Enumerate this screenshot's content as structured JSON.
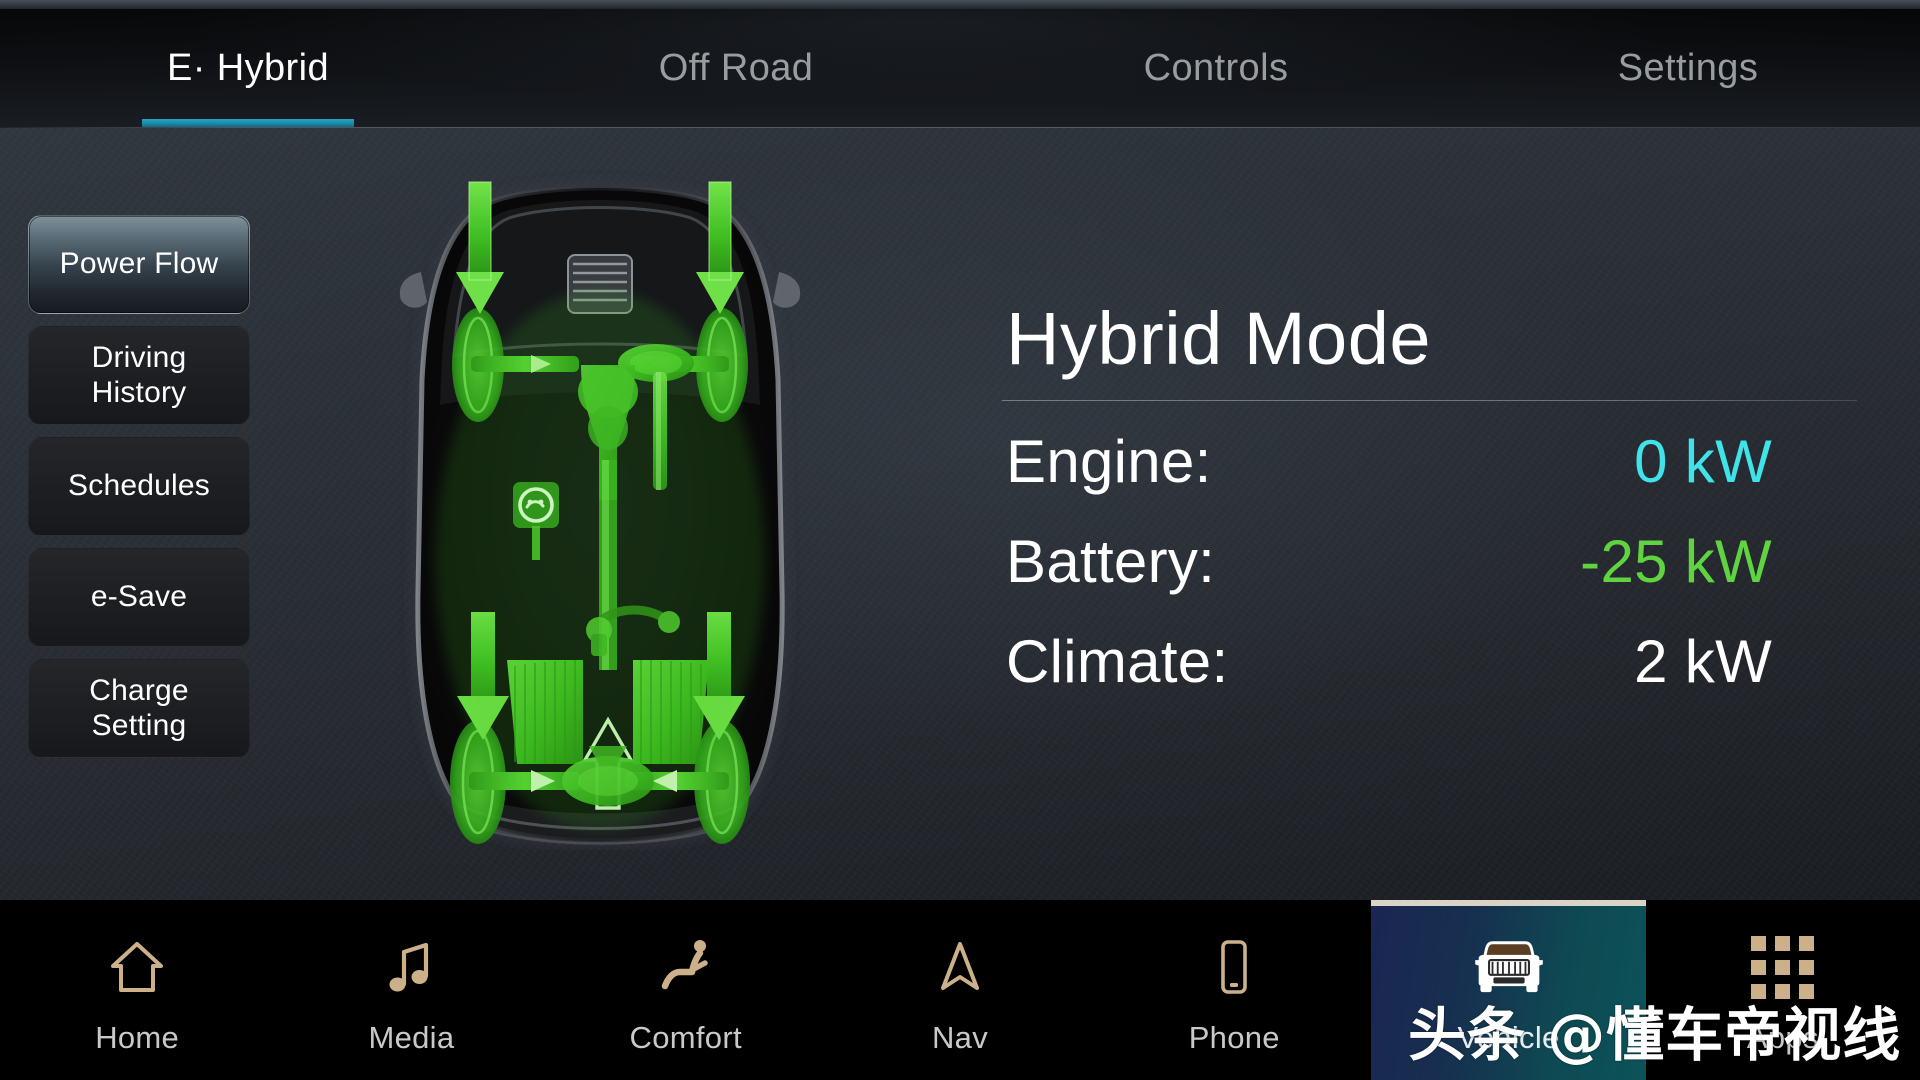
{
  "app": {
    "screen_title": "Hybrid Mode"
  },
  "tabs": [
    {
      "label": "E· Hybrid",
      "active": true
    },
    {
      "label": "Off Road",
      "active": false
    },
    {
      "label": "Controls",
      "active": false
    },
    {
      "label": "Settings",
      "active": false
    }
  ],
  "sidebar": {
    "items": [
      {
        "label": "Power Flow",
        "active": true
      },
      {
        "label": "Driving\nHistory",
        "line1": "Driving",
        "line2": "History",
        "active": false
      },
      {
        "label": "Schedules",
        "active": false
      },
      {
        "label": "e-Save",
        "active": false
      },
      {
        "label": "Charge\nSetting",
        "line1": "Charge",
        "line2": "Setting",
        "active": false
      }
    ]
  },
  "info_panel": {
    "title": "Hybrid Mode",
    "rows": [
      {
        "label": "Engine:",
        "value": "0 kW",
        "color": "#3fe3e8"
      },
      {
        "label": "Battery:",
        "value": "-25 kW",
        "color": "#5fd340"
      },
      {
        "label": "Climate:",
        "value": "2 kW",
        "color": "#ffffff"
      }
    ]
  },
  "bottom_nav": {
    "items": [
      {
        "label": "Home",
        "icon": "home-icon",
        "active": false
      },
      {
        "label": "Media",
        "icon": "music-note-icon",
        "active": false
      },
      {
        "label": "Comfort",
        "icon": "seat-person-icon",
        "active": false
      },
      {
        "label": "Nav",
        "icon": "navigation-arrow-icon",
        "active": false
      },
      {
        "label": "Phone",
        "icon": "phone-icon",
        "active": false
      },
      {
        "label": "Vehicle",
        "icon": "car-front-icon",
        "active": true
      },
      {
        "label": "Apps",
        "icon": "apps-grid-icon",
        "active": false
      }
    ]
  },
  "watermark": {
    "text": "头条 @懂车帝视线"
  },
  "vehicle_graphic": {
    "name": "power-flow-vehicle-diagram",
    "description": "Top-down x-ray vehicle with green powertrain highlight",
    "flow_color": "#3fbf21",
    "body_color": "#0a0a0a"
  },
  "theme": {
    "accent_teal": "#1b8aab",
    "value_cyan": "#3fe3e8",
    "value_green": "#5fd340",
    "icon_tan": "#cbb08a",
    "background": "#2a2f36",
    "nav_background": "#000000"
  }
}
